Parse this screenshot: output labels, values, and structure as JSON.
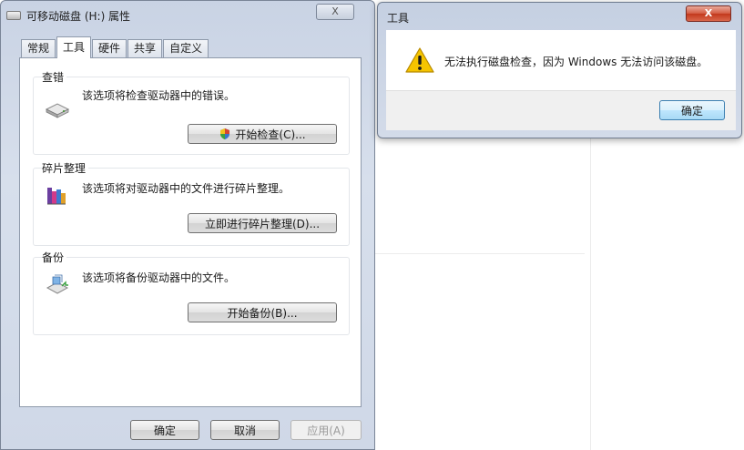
{
  "properties_window": {
    "title": "可移动磁盘 (H:) 属性",
    "close_label": "X",
    "tabs": [
      {
        "label": "常规"
      },
      {
        "label": "工具"
      },
      {
        "label": "硬件"
      },
      {
        "label": "共享"
      },
      {
        "label": "自定义"
      }
    ],
    "active_tab": "工具",
    "groups": {
      "check": {
        "label": "查错",
        "description": "该选项将检查驱动器中的错误。",
        "button_label": "开始检查(C)...",
        "icon": "drive-icon"
      },
      "defrag": {
        "label": "碎片整理",
        "description": "该选项将对驱动器中的文件进行碎片整理。",
        "button_label": "立即进行碎片整理(D)...",
        "icon": "defrag-icon"
      },
      "backup": {
        "label": "备份",
        "description": "该选项将备份驱动器中的文件。",
        "button_label": "开始备份(B)...",
        "icon": "backup-icon"
      }
    },
    "footer": {
      "ok_label": "确定",
      "cancel_label": "取消",
      "apply_label": "应用(A)"
    }
  },
  "message_box": {
    "title": "工具",
    "close_label": "X",
    "message": "无法执行磁盘检查，因为 Windows 无法访问该磁盘。",
    "icon": "warning-icon",
    "ok_label": "确定"
  },
  "colors": {
    "window_frame": "#c9d3e4",
    "close_red": "#c2381c",
    "warning_yellow": "#f5c400"
  }
}
